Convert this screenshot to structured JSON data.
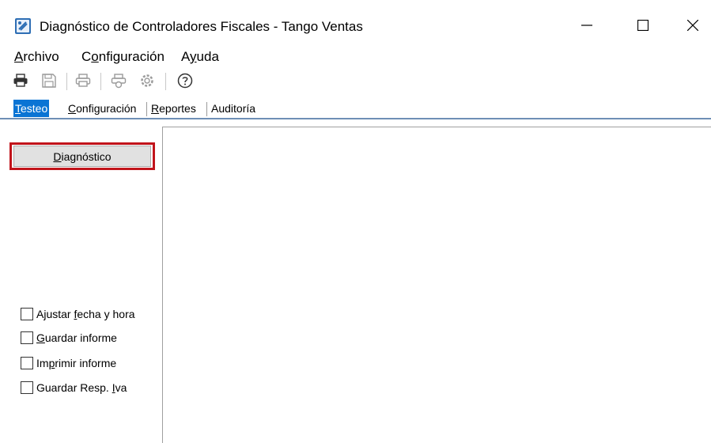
{
  "window": {
    "title": "Diagnóstico de Controladores Fiscales - Tango Ventas",
    "minimize_glyph": "—",
    "maximize_glyph": "☐",
    "close_glyph": "✕"
  },
  "menu": {
    "items": [
      {
        "accel": "A",
        "rest": "rchivo"
      },
      {
        "pre": "C",
        "accel": "o",
        "rest": "nfiguración"
      },
      {
        "pre": "A",
        "accel": "y",
        "rest": "uda"
      }
    ]
  },
  "toolbar": {
    "icons": [
      "print-icon",
      "save-icon",
      "print-preview-icon",
      "printer-settings-icon",
      "settings-icon",
      "help-icon"
    ]
  },
  "tabs": [
    {
      "accel": "T",
      "rest": "esteo",
      "active": true
    },
    {
      "accel": "C",
      "rest": "onfiguración",
      "active": false
    },
    {
      "accel": "R",
      "rest": "eportes",
      "active": false
    },
    {
      "label": "Auditoría",
      "active": false
    }
  ],
  "left_panel": {
    "diagnose_button": {
      "accel": "D",
      "rest": "iagnóstico"
    },
    "checkboxes": [
      {
        "pre": "Ajustar ",
        "accel": "f",
        "rest": "echa y hora",
        "checked": false
      },
      {
        "pre": "",
        "accel": "G",
        "rest": "uardar informe",
        "checked": false
      },
      {
        "pre": "Im",
        "accel": "p",
        "rest": "rimir informe",
        "checked": false
      },
      {
        "pre": "Guardar Resp. ",
        "accel": "I",
        "rest": "va",
        "checked": false
      }
    ]
  },
  "colors": {
    "active_tab": "#0a74d4",
    "highlight_border": "#c1141b",
    "button_face": "#e1e1e1"
  }
}
